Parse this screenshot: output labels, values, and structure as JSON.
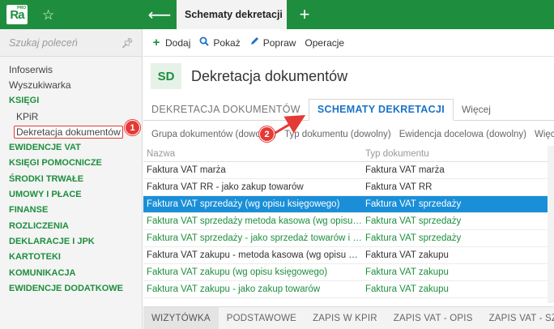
{
  "app": {
    "logo_text": "Ra",
    "logo_superscript": "PRO",
    "active_tab": "Schematy dekretacji",
    "colors": {
      "brand": "#1e8e3e",
      "accent": "#1a73c8",
      "selection": "#1a8fd8",
      "highlight": "#e53935"
    }
  },
  "sidebar": {
    "search_placeholder": "Szukaj poleceń",
    "items": [
      {
        "label": "Infoserwis"
      },
      {
        "label": "Wyszukiwarka"
      },
      {
        "label": "KSIĘGI"
      },
      {
        "label": "KPiR"
      },
      {
        "label": "Dekretacja dokumentów"
      },
      {
        "label": "EWIDENCJE VAT"
      },
      {
        "label": "KSIĘGI POMOCNICZE"
      },
      {
        "label": "ŚRODKI TRWAŁE"
      },
      {
        "label": "UMOWY I PŁACE"
      },
      {
        "label": "FINANSE"
      },
      {
        "label": "ROZLICZENIA"
      },
      {
        "label": "DEKLARACJE I JPK"
      },
      {
        "label": "KARTOTEKI"
      },
      {
        "label": "KOMUNIKACJA"
      },
      {
        "label": "EWIDENCJE DODATKOWE"
      }
    ]
  },
  "callouts": {
    "step1": "1",
    "step2": "2"
  },
  "toolbar": {
    "add": "Dodaj",
    "show": "Pokaż",
    "edit": "Popraw",
    "operations": "Operacje"
  },
  "page": {
    "icon_text": "SD",
    "title": "Dekretacja dokumentów"
  },
  "tabs": {
    "t1": "DEKRETACJA DOKUMENTÓW",
    "t2": "SCHEMATY DEKRETACJI",
    "t3": "Więcej"
  },
  "filters": {
    "f1": "Grupa dokumentów (dowolna)",
    "f2": "Typ dokumentu (dowolny)",
    "f3": "Ewidencja docelowa (dowolny)",
    "f4": "Więcej"
  },
  "table": {
    "headers": {
      "name": "Nazwa",
      "type": "Typ dokumentu"
    },
    "rows": [
      {
        "name": "Faktura VAT marża",
        "type": "Faktura VAT marża"
      },
      {
        "name": "Faktura VAT RR - jako zakup towarów",
        "type": "Faktura VAT RR"
      },
      {
        "name": "Faktura VAT sprzedaży (wg opisu księgowego)",
        "type": "Faktura VAT sprzedaży"
      },
      {
        "name": "Faktura VAT sprzedaży metoda kasowa (wg opisu księgowego)",
        "type": "Faktura VAT sprzedaży"
      },
      {
        "name": "Faktura VAT sprzedaży - jako sprzedaż towarów i usług",
        "type": "Faktura VAT sprzedaży"
      },
      {
        "name": "Faktura VAT zakupu - metoda kasowa (wg opisu księgowego)",
        "type": "Faktura VAT zakupu"
      },
      {
        "name": "Faktura VAT zakupu (wg opisu księgowego)",
        "type": "Faktura VAT zakupu"
      },
      {
        "name": "Faktura VAT zakupu - jako zakup towarów",
        "type": "Faktura VAT zakupu"
      }
    ]
  },
  "bottom_tabs": {
    "b1": "WIZYTÓWKA",
    "b2": "PODSTAWOWE",
    "b3": "ZAPIS W KPIR",
    "b4": "ZAPIS VAT - OPIS",
    "b5": "ZAPIS VAT - SZCZEGÓŁY"
  }
}
